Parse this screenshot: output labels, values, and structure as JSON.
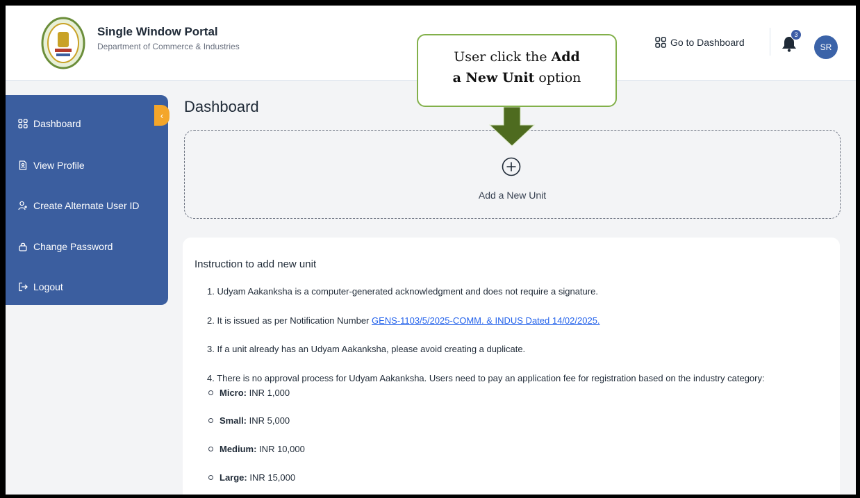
{
  "header": {
    "title": "Single Window Portal",
    "subtitle": "Department of Commerce & Industries",
    "go_to_dashboard": "Go to Dashboard",
    "notification_count": "3",
    "avatar_initials": "SR"
  },
  "sidebar": {
    "items": [
      {
        "label": "Dashboard",
        "icon": "grid-icon"
      },
      {
        "label": "View Profile",
        "icon": "profile-doc-icon"
      },
      {
        "label": "Create Alternate User ID",
        "icon": "user-add-icon"
      },
      {
        "label": "Change Password",
        "icon": "lock-icon"
      },
      {
        "label": "Logout",
        "icon": "logout-icon"
      }
    ],
    "collapse_glyph": "‹"
  },
  "main": {
    "title": "Dashboard",
    "add_unit_label": "Add a New Unit"
  },
  "instructions": {
    "title": "Instruction to add new unit",
    "item1": "1. Udyam Aakanksha is a computer-generated acknowledgment and does not require a signature.",
    "item2_prefix": "2. It is issued as per Notification Number ",
    "item2_link": "GENS-1103/5/2025-COMM. & INDUS Dated 14/02/2025.",
    "item3": "3. If a unit already has an Udyam Aakanksha, please avoid creating a duplicate.",
    "item4": "4. There is no approval process for Udyam Aakanksha. Users need to pay an application fee for registration based on the industry category:",
    "fees": [
      {
        "name": "Micro:",
        "value": " INR 1,000"
      },
      {
        "name": "Small:",
        "value": " INR 5,000"
      },
      {
        "name": "Medium:",
        "value": " INR 10,000"
      },
      {
        "name": "Large:",
        "value": " INR 15,000"
      }
    ]
  },
  "callout": {
    "line1_prefix": "User click the ",
    "line1_bold": "Add",
    "line2_bold": "a New Unit",
    "line2_suffix": " option"
  },
  "colors": {
    "sidebar": "#3b5e9f",
    "accent": "#f4a62a",
    "arrow": "#4e6b1f",
    "callout_border": "#82b04a",
    "link": "#2563eb"
  }
}
